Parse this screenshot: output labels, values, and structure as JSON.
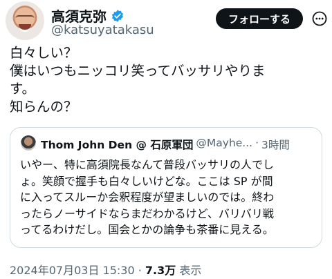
{
  "author": {
    "name": "高須克弥",
    "handle": "@katsuyatakasu"
  },
  "follow_button": {
    "label": "フォローする"
  },
  "tweet": {
    "text": "白々しい？\n僕はいつもニッコリ笑ってバッサリやりま\nす。\n知らんの？"
  },
  "quote": {
    "name": "Thom John Den @ 石原軍団",
    "handle": "@Mayhe...",
    "separator": "·",
    "time": "3時間",
    "text": "いやー、特に高須院長なんて普段バッサリの人でし\nょ。笑顔で握手も白々しいけどな。ここは SP が間\nに入ってスルーか会釈程度が望ましいのでは。終わ\nったらノーサイドならまだわかるけど、バリバリ戦\nってるわけだし。国会とかの論争も茶番に見える。"
  },
  "meta": {
    "timestamp": "2024年07月03日 15:30",
    "separator": "·",
    "views": "7.3万",
    "views_label": "表示"
  },
  "colors": {
    "verified": "#1d9bf0",
    "button_bg": "#0f1419",
    "secondary_text": "#536471",
    "border": "#cfd9de"
  }
}
